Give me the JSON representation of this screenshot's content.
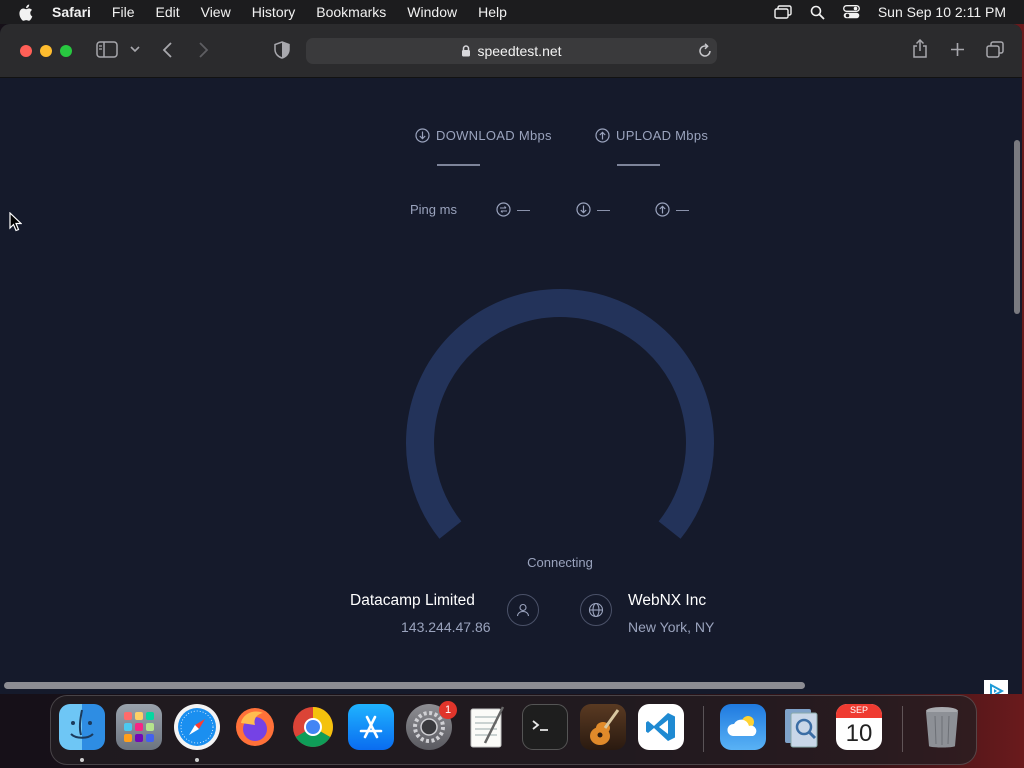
{
  "menubar": {
    "app": "Safari",
    "items": [
      "File",
      "Edit",
      "View",
      "History",
      "Bookmarks",
      "Window",
      "Help"
    ],
    "clock": "Sun Sep 10  2:11 PM"
  },
  "browser": {
    "url": "speedtest.net"
  },
  "speedtest": {
    "download_label": "DOWNLOAD Mbps",
    "upload_label": "UPLOAD Mbps",
    "ping_label": "Ping  ms",
    "jitter_value": "—",
    "ping_down_value": "—",
    "ping_up_value": "—",
    "status": "Connecting",
    "isp_name": "Datacamp Limited",
    "isp_ip": "143.244.47.86",
    "server_name": "WebNX Inc",
    "server_location": "New York, NY"
  },
  "dock": {
    "apps": [
      "Finder",
      "Launchpad",
      "Safari",
      "Firefox",
      "Chrome",
      "App Store",
      "System Settings",
      "TextEdit",
      "Terminal",
      "GarageBand",
      "Visual Studio Code",
      "Weather",
      "Preview",
      "Calendar",
      "Trash"
    ],
    "settings_badge": "1",
    "calendar_month": "SEP",
    "calendar_day": "10"
  },
  "colors": {
    "page_bg": "#151a2b",
    "gauge": "#23335a",
    "toolbar": "#2b2b2d"
  }
}
